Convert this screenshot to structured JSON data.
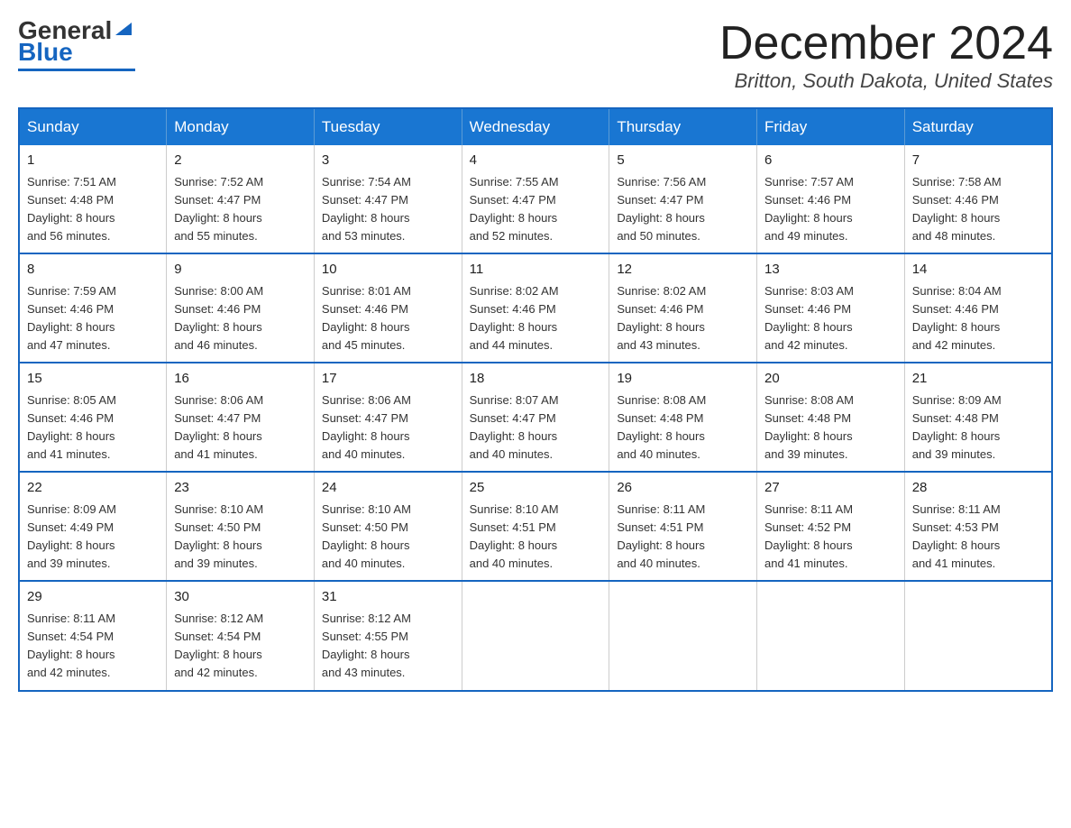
{
  "logo": {
    "general": "General",
    "blue": "Blue",
    "triangle": "▶"
  },
  "header": {
    "month_title": "December 2024",
    "location": "Britton, South Dakota, United States"
  },
  "days_of_week": [
    "Sunday",
    "Monday",
    "Tuesday",
    "Wednesday",
    "Thursday",
    "Friday",
    "Saturday"
  ],
  "weeks": [
    [
      {
        "day": "1",
        "sunrise": "7:51 AM",
        "sunset": "4:48 PM",
        "daylight": "8 hours and 56 minutes."
      },
      {
        "day": "2",
        "sunrise": "7:52 AM",
        "sunset": "4:47 PM",
        "daylight": "8 hours and 55 minutes."
      },
      {
        "day": "3",
        "sunrise": "7:54 AM",
        "sunset": "4:47 PM",
        "daylight": "8 hours and 53 minutes."
      },
      {
        "day": "4",
        "sunrise": "7:55 AM",
        "sunset": "4:47 PM",
        "daylight": "8 hours and 52 minutes."
      },
      {
        "day": "5",
        "sunrise": "7:56 AM",
        "sunset": "4:47 PM",
        "daylight": "8 hours and 50 minutes."
      },
      {
        "day": "6",
        "sunrise": "7:57 AM",
        "sunset": "4:46 PM",
        "daylight": "8 hours and 49 minutes."
      },
      {
        "day": "7",
        "sunrise": "7:58 AM",
        "sunset": "4:46 PM",
        "daylight": "8 hours and 48 minutes."
      }
    ],
    [
      {
        "day": "8",
        "sunrise": "7:59 AM",
        "sunset": "4:46 PM",
        "daylight": "8 hours and 47 minutes."
      },
      {
        "day": "9",
        "sunrise": "8:00 AM",
        "sunset": "4:46 PM",
        "daylight": "8 hours and 46 minutes."
      },
      {
        "day": "10",
        "sunrise": "8:01 AM",
        "sunset": "4:46 PM",
        "daylight": "8 hours and 45 minutes."
      },
      {
        "day": "11",
        "sunrise": "8:02 AM",
        "sunset": "4:46 PM",
        "daylight": "8 hours and 44 minutes."
      },
      {
        "day": "12",
        "sunrise": "8:02 AM",
        "sunset": "4:46 PM",
        "daylight": "8 hours and 43 minutes."
      },
      {
        "day": "13",
        "sunrise": "8:03 AM",
        "sunset": "4:46 PM",
        "daylight": "8 hours and 42 minutes."
      },
      {
        "day": "14",
        "sunrise": "8:04 AM",
        "sunset": "4:46 PM",
        "daylight": "8 hours and 42 minutes."
      }
    ],
    [
      {
        "day": "15",
        "sunrise": "8:05 AM",
        "sunset": "4:46 PM",
        "daylight": "8 hours and 41 minutes."
      },
      {
        "day": "16",
        "sunrise": "8:06 AM",
        "sunset": "4:47 PM",
        "daylight": "8 hours and 41 minutes."
      },
      {
        "day": "17",
        "sunrise": "8:06 AM",
        "sunset": "4:47 PM",
        "daylight": "8 hours and 40 minutes."
      },
      {
        "day": "18",
        "sunrise": "8:07 AM",
        "sunset": "4:47 PM",
        "daylight": "8 hours and 40 minutes."
      },
      {
        "day": "19",
        "sunrise": "8:08 AM",
        "sunset": "4:48 PM",
        "daylight": "8 hours and 40 minutes."
      },
      {
        "day": "20",
        "sunrise": "8:08 AM",
        "sunset": "4:48 PM",
        "daylight": "8 hours and 39 minutes."
      },
      {
        "day": "21",
        "sunrise": "8:09 AM",
        "sunset": "4:48 PM",
        "daylight": "8 hours and 39 minutes."
      }
    ],
    [
      {
        "day": "22",
        "sunrise": "8:09 AM",
        "sunset": "4:49 PM",
        "daylight": "8 hours and 39 minutes."
      },
      {
        "day": "23",
        "sunrise": "8:10 AM",
        "sunset": "4:50 PM",
        "daylight": "8 hours and 39 minutes."
      },
      {
        "day": "24",
        "sunrise": "8:10 AM",
        "sunset": "4:50 PM",
        "daylight": "8 hours and 40 minutes."
      },
      {
        "day": "25",
        "sunrise": "8:10 AM",
        "sunset": "4:51 PM",
        "daylight": "8 hours and 40 minutes."
      },
      {
        "day": "26",
        "sunrise": "8:11 AM",
        "sunset": "4:51 PM",
        "daylight": "8 hours and 40 minutes."
      },
      {
        "day": "27",
        "sunrise": "8:11 AM",
        "sunset": "4:52 PM",
        "daylight": "8 hours and 41 minutes."
      },
      {
        "day": "28",
        "sunrise": "8:11 AM",
        "sunset": "4:53 PM",
        "daylight": "8 hours and 41 minutes."
      }
    ],
    [
      {
        "day": "29",
        "sunrise": "8:11 AM",
        "sunset": "4:54 PM",
        "daylight": "8 hours and 42 minutes."
      },
      {
        "day": "30",
        "sunrise": "8:12 AM",
        "sunset": "4:54 PM",
        "daylight": "8 hours and 42 minutes."
      },
      {
        "day": "31",
        "sunrise": "8:12 AM",
        "sunset": "4:55 PM",
        "daylight": "8 hours and 43 minutes."
      },
      null,
      null,
      null,
      null
    ]
  ],
  "labels": {
    "sunrise": "Sunrise:",
    "sunset": "Sunset:",
    "daylight": "Daylight:"
  }
}
